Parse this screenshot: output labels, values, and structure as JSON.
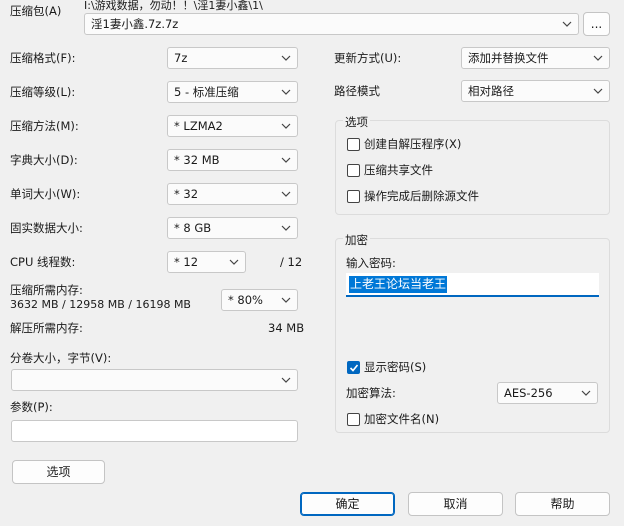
{
  "archive": {
    "label": "压缩包(A)",
    "path_line": "I:\\游戏数据，勿动！！\\淫1妻小鑫\\1\\",
    "name_value": "淫1妻小鑫.7z.7z",
    "browse_label": "..."
  },
  "left": {
    "format": {
      "label": "压缩格式(F):",
      "value": "7z"
    },
    "level": {
      "label": "压缩等级(L):",
      "value": "5 - 标准压缩"
    },
    "method": {
      "label": "压缩方法(M):",
      "value": "*  LZMA2"
    },
    "dict": {
      "label": "字典大小(D):",
      "value": "*  32 MB"
    },
    "word": {
      "label": "单词大小(W):",
      "value": "*  32"
    },
    "solid": {
      "label": "固实数据大小:",
      "value": "*  8 GB"
    },
    "cpu": {
      "label": "CPU 线程数:",
      "value": "*  12",
      "total": "/ 12"
    },
    "mem_compress": {
      "label": "压缩所需内存:",
      "detail": "3632 MB / 12958 MB / 16198 MB",
      "value": "*  80%"
    },
    "mem_decompress": {
      "label": "解压所需内存:",
      "value": "34 MB"
    },
    "volume": {
      "label": "分卷大小，字节(V):",
      "value": ""
    },
    "params": {
      "label": "参数(P):",
      "value": ""
    },
    "options_button": "选项"
  },
  "right": {
    "update": {
      "label": "更新方式(U):",
      "value": "添加并替换文件"
    },
    "path_mode": {
      "label": "路径模式",
      "value": "相对路径"
    },
    "options_group": {
      "title": "选项",
      "sfx": "创建自解压程序(X)",
      "shared": "压缩共享文件",
      "delete": "操作完成后删除源文件"
    },
    "encrypt_group": {
      "title": "加密",
      "password_label": "输入密码:",
      "password_value": "上老王论坛当老王",
      "show_password": "显示密码(S)",
      "method_label": "加密算法:",
      "method_value": "AES-256",
      "encrypt_names": "加密文件名(N)"
    }
  },
  "buttons": {
    "ok": "确定",
    "cancel": "取消",
    "help": "帮助"
  },
  "accent": "#0067c0"
}
